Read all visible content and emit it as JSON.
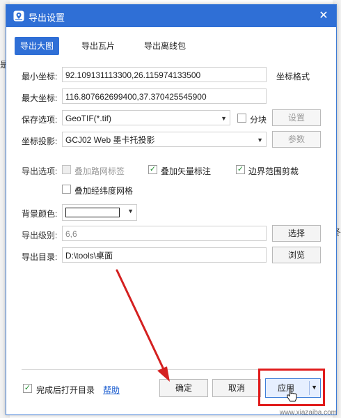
{
  "window": {
    "title": "导出设置"
  },
  "tabs": [
    {
      "label": "导出大图",
      "active": true
    },
    {
      "label": "导出瓦片",
      "active": false
    },
    {
      "label": "导出离线包",
      "active": false
    }
  ],
  "fields": {
    "min_coord": {
      "label": "最小坐标:",
      "value": "92.109131113300,26.115974133500"
    },
    "max_coord": {
      "label": "最大坐标:",
      "value": "116.807662699400,37.370425545900"
    },
    "coord_format": "坐标格式",
    "save_option": {
      "label": "保存选项:",
      "value": "GeoTIF(*.tif)",
      "split_label": "分块",
      "settings_button": "设置"
    },
    "projection": {
      "label": "坐标投影:",
      "value": "GCJ02 Web 墨卡托投影",
      "params_button": "参数"
    }
  },
  "export_options": {
    "label": "导出选项:",
    "items": [
      {
        "label": "叠加路网标签",
        "checked": false,
        "disabled": true
      },
      {
        "label": "叠加矢量标注",
        "checked": true,
        "disabled": false
      },
      {
        "label": "边界范围剪裁",
        "checked": true,
        "disabled": false
      },
      {
        "label": "叠加经纬度网格",
        "checked": false,
        "disabled": false
      }
    ]
  },
  "background_color": {
    "label": "背景颜色:",
    "value": "#ffffff"
  },
  "export_level": {
    "label": "导出级别:",
    "value": "6,6",
    "button": "选择"
  },
  "export_dir": {
    "label": "导出目录:",
    "value": "D:\\tools\\桌面",
    "button": "浏览"
  },
  "footer": {
    "open_after_label": "完成后打开目录",
    "open_after_checked": true,
    "help_link": "帮助",
    "ok_button": "确定",
    "cancel_button": "取消",
    "apply_button": "应用"
  },
  "background_chars": {
    "left": "是",
    "right": "冬"
  },
  "watermark": "www.xiazaiba.com",
  "icons": {
    "app": "map-logo-icon",
    "close": "close-icon",
    "dropdown": "chevron-down-icon",
    "check": "check-icon"
  },
  "colors": {
    "titlebar": "#2f6fd6",
    "accent": "#2f6fd6",
    "highlight_box": "#e01b1b",
    "arrow": "#d42020"
  }
}
